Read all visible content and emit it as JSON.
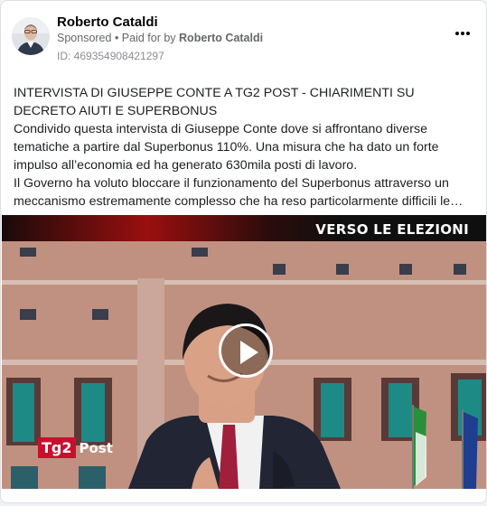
{
  "post": {
    "page_name": "Roberto Cataldi",
    "sponsored_label": "Sponsored",
    "separator": " • ",
    "paid_for_prefix": "Paid for by ",
    "paid_for_name": "Roberto Cataldi",
    "ad_id": "ID: 469354908421297",
    "headline": "INTERVISTA DI GIUSEPPE CONTE A TG2 POST - CHIARIMENTI SU DECRETO AIUTI E SUPERBONUS",
    "paragraph_1": "Condivido questa intervista di Giuseppe Conte dove si affrontano diverse tematiche a partire dal Superbonus 110%. Una misura che ha dato un forte impulso all’economia ed ha generato 630mila posti di lavoro.",
    "paragraph_2": "Il Governo ha voluto bloccare il funzionamento del Superbonus attraverso un meccanismo estremamente complesso che ha reso particolarmente difficili le…"
  },
  "video": {
    "banner_text": "VERSO LE ELEZIONI",
    "logo_mark": "Tg2",
    "logo_word": "Post"
  },
  "colors": {
    "banner_red": "#9a0f0f",
    "logo_red": "#c8102e",
    "text_secondary": "#65676b"
  },
  "icons": [
    "more-options-icon",
    "play-icon",
    "avatar"
  ]
}
